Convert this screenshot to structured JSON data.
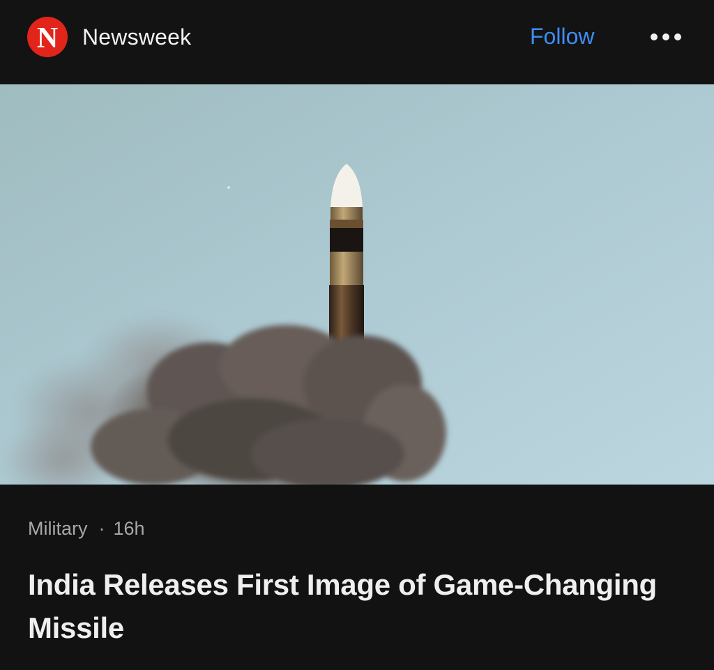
{
  "header": {
    "source_name": "Newsweek",
    "logo_letter": "N",
    "follow_label": "Follow",
    "more_icon": "more-horizontal-icon"
  },
  "article": {
    "category": "Military",
    "separator": "·",
    "age": "16h",
    "headline": "India Releases First Image of Game-Changing Missile"
  },
  "colors": {
    "background": "#121212",
    "accent": "#3d8ef2",
    "logo_red": "#e1251b",
    "meta_text": "#a8a8a8",
    "headline_text": "#efefef"
  }
}
